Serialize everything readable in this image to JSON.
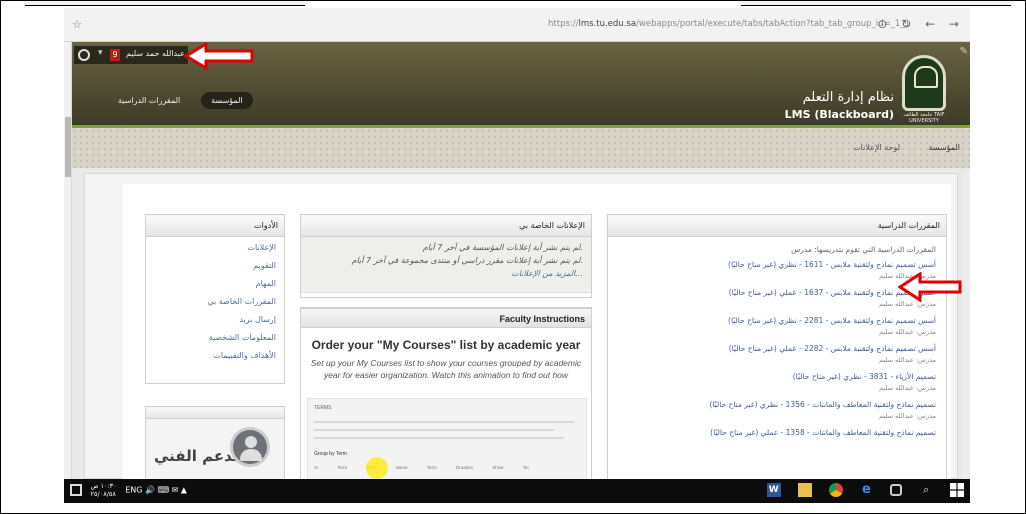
{
  "browser": {
    "star": "☆",
    "url_prefix": "https://",
    "url_host": "lms.tu.edu.sa",
    "url_path": "/webapps/portal/execute/tabs/tabAction?tab_tab_group_id=_1_1",
    "nav_glyphs": "⊙ ↻ ← →"
  },
  "lms": {
    "user_name": "عبدالله حمد سليم",
    "red_badge": "9",
    "tabs": [
      "المؤسسة",
      "المقررات الدراسية"
    ],
    "title_ar": "نظام إدارة التعلم",
    "title_en": "LMS (Blackboard)",
    "logo_text": "جامعة الطائف TAIF UNIVERSITY",
    "breadcrumb": [
      "المؤسسة",
      "لوحة الإعلانات"
    ]
  },
  "tools": {
    "title": "الأدوات",
    "items": [
      "الإعلانات",
      "التقويم",
      "المهام",
      "المقررات الخاصة بي",
      "إرسال بريد",
      "المعلومات الشخصية",
      "الأهداف والتقييمات"
    ]
  },
  "announcements": {
    "title": "الإعلانات الخاصة بي",
    "line1": "لم يتم نشر أية إعلانات المؤسسة في آخر 7 أيام.",
    "line2": "لم يتم نشر أية إعلانات مقرر دراسي أو منتدى مجموعة في آخر 7 أيام.",
    "link": "المزيد من الإعلانات..."
  },
  "faculty": {
    "header": "Faculty Instructions",
    "title": "Order your \"My Courses\" list by academic year",
    "subtitle": "Set up your My Courses list to show your courses grouped by academic year for easier organization. Watch this animation to find out how",
    "video_title": "TERMS",
    "video_checkbox": "Group by Term",
    "video_cols": "% Term Term Name Term Duration Show Ter"
  },
  "courses": {
    "title": "المقررات الدراسية",
    "intro": "المقررات الدراسية التي تقوم بتدريسها: مدرس",
    "list": [
      {
        "name": "أسس تصميم نماذج ولتقنية ملابس - 1611 - نظري (غير متاح حاليًا)",
        "instructor": "مدرس: عبدالله سليم"
      },
      {
        "name": "أسس تصميم نماذج ولتقنية ملابس - 1637 - عملي (غير متاح حاليًا)",
        "instructor": "مدرس: عبدالله سليم"
      },
      {
        "name": "أسس تصميم نماذج ولتقنية ملابس - 2281 - نظري (غير متاح حاليًا)",
        "instructor": "مدرس: عبدالله سليم"
      },
      {
        "name": "أسس تصميم نماذج ولتقنية ملابس - 2282 - عملي (غير متاح حاليًا)",
        "instructor": "مدرس: عبدالله سليم"
      },
      {
        "name": "تصميم الأزياء - 3831 - نظري (غير متاح حاليًا)",
        "instructor": "مدرس: عبدالله سليم"
      },
      {
        "name": "تصميم نماذج ولتقنية المعاطف والمانتات - 1356 - نظري (غير متاح حاليًا)",
        "instructor": "مدرس: عبدالله سليم"
      },
      {
        "name": "تصميم نماذج ولتقنية المعاطف والمانتات - 1358 - عملي (غير متاح حاليًا)",
        "instructor": ""
      }
    ]
  },
  "support": {
    "label": "الدعم الفني"
  },
  "taskbar": {
    "time": "١٠:٣٠ ص",
    "date": "٢٥/٠٨/٥٨",
    "lang": "ENG  🔊  ⌨  ✉  ▲"
  },
  "colors": {
    "header": "#4e4a32",
    "accent_green": "#7fa33b",
    "link_blue": "#3f5f95",
    "annotation_red": "#e00000"
  }
}
